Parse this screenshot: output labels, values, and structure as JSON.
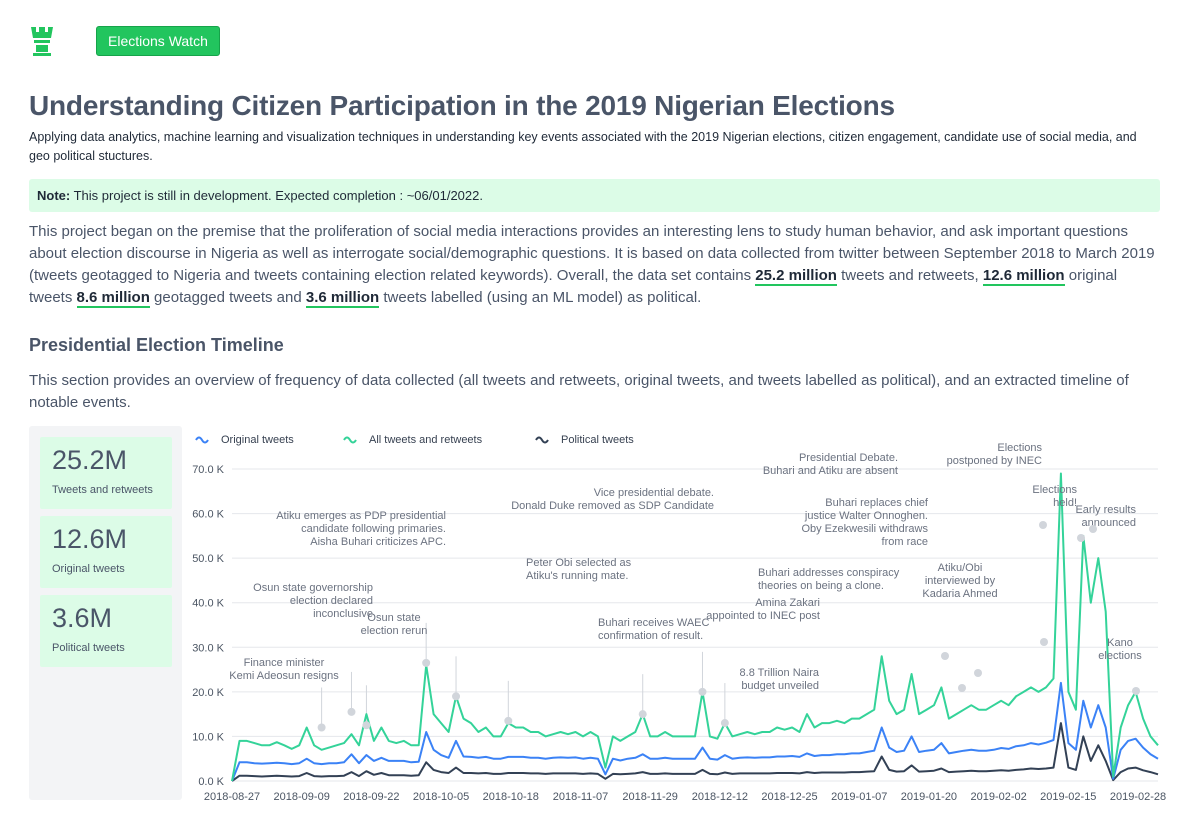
{
  "header": {
    "brand_button": "Elections Watch",
    "title": "Understanding Citizen Participation in the 2019 Nigerian Elections",
    "subtitle": "Applying data analytics, machine learning and visualization techniques in understanding key events associated with the 2019 Nigerian elections, citizen engagement, candidate use of social media, and geo political stuctures."
  },
  "note": {
    "label": "Note:",
    "text": "This project is still in development. Expected completion : ~06/01/2022."
  },
  "intro": {
    "p1": "This project began on the premise that the proliferation of social media interactions provides an interesting lens to study human behavior, and ask important questions about election discourse in Nigeria as well as interrogate social/demographic questions. It is based on data collected from twitter between September 2018 to March 2019 (tweets geotagged to Nigeria and tweets containing election related keywords). Overall, the data set contains ",
    "h1": "25.2 million",
    "p2": " tweets and retweets, ",
    "h2": "12.6 million",
    "p3": " original tweets ",
    "h3": "8.6 million",
    "p4": " geotagged tweets and ",
    "h4": "3.6 million",
    "p5": " tweets labelled (using an ML model) as political."
  },
  "section": {
    "heading": "Presidential Election Timeline",
    "description": "This section provides an overview of frequency of data collected (all tweets and retweets, original tweets, and tweets labelled as political), and an extracted timeline of notable events."
  },
  "stats": [
    {
      "value": "25.2M",
      "label": "Tweets and retweets"
    },
    {
      "value": "12.6M",
      "label": "Original tweets"
    },
    {
      "value": "3.6M",
      "label": "Political tweets"
    }
  ],
  "colors": {
    "all": "#34d399",
    "original": "#3b82f6",
    "political": "#334155",
    "accent": "#22c55e"
  },
  "chart_data": {
    "type": "line",
    "ylim": [
      0,
      70000
    ],
    "yticks": [
      "0.0 K",
      "10.0 K",
      "20.0 K",
      "30.0 K",
      "40.0 K",
      "50.0 K",
      "60.0 K",
      "70.0 K"
    ],
    "xticks": [
      "2018-08-27",
      "2018-09-09",
      "2018-09-22",
      "2018-10-05",
      "2018-10-18",
      "2018-11-07",
      "2018-11-29",
      "2018-12-12",
      "2018-12-25",
      "2019-01-07",
      "2019-01-20",
      "2019-02-02",
      "2019-02-15",
      "2019-02-28"
    ],
    "legend": [
      "Original tweets",
      "All tweets and retweets",
      "Political tweets"
    ],
    "series": [
      {
        "name": "All tweets and retweets",
        "key": "all",
        "values": [
          0,
          9000,
          9000,
          8500,
          8000,
          8000,
          8700,
          8000,
          7200,
          8000,
          12000,
          8000,
          7000,
          7500,
          8000,
          8500,
          10500,
          8000,
          15000,
          9000,
          12000,
          9000,
          8500,
          9000,
          8000,
          8000,
          26000,
          15000,
          13000,
          11000,
          19000,
          14000,
          13000,
          11000,
          12000,
          10000,
          10000,
          13000,
          12000,
          12000,
          11000,
          11000,
          10000,
          10500,
          11000,
          10500,
          11000,
          10000,
          11000,
          10000,
          3000,
          10000,
          9000,
          10000,
          11000,
          15000,
          10000,
          10000,
          11000,
          10000,
          10000,
          10000,
          10000,
          20000,
          10000,
          9500,
          13000,
          10000,
          10500,
          11000,
          10500,
          11000,
          11000,
          12000,
          11500,
          12000,
          11000,
          15000,
          12000,
          13000,
          13000,
          13500,
          13000,
          14000,
          14000,
          15000,
          16000,
          28000,
          18000,
          15000,
          16000,
          24000,
          15000,
          16000,
          17000,
          21000,
          14000,
          15000,
          16000,
          17000,
          16000,
          16000,
          17000,
          18000,
          17000,
          19000,
          20000,
          21000,
          20000,
          21000,
          23000,
          69000,
          20000,
          16000,
          55000,
          40000,
          50000,
          38000,
          1000,
          12000,
          17000,
          20000,
          14000,
          10000,
          8000
        ]
      },
      {
        "name": "Original tweets",
        "key": "original",
        "values": [
          0,
          4200,
          4200,
          4000,
          3900,
          4000,
          4100,
          4000,
          3800,
          4000,
          5000,
          4000,
          3800,
          4000,
          4000,
          4200,
          6000,
          4000,
          5800,
          4500,
          5200,
          4500,
          4500,
          4500,
          4200,
          4300,
          11000,
          7000,
          5800,
          5200,
          9000,
          5500,
          5400,
          5200,
          5400,
          5000,
          5000,
          5400,
          5400,
          5400,
          5200,
          5200,
          5000,
          5200,
          5300,
          5200,
          5300,
          5000,
          5200,
          5000,
          1500,
          5000,
          4600,
          5000,
          5200,
          6000,
          5000,
          5000,
          5200,
          5000,
          5000,
          5000,
          5000,
          7500,
          5000,
          4800,
          5800,
          5000,
          5200,
          5300,
          5200,
          5300,
          5300,
          5500,
          5500,
          5600,
          5400,
          6200,
          5600,
          5800,
          5800,
          6000,
          6000,
          6200,
          6200,
          6500,
          6800,
          12000,
          7500,
          6500,
          6800,
          10000,
          6500,
          6800,
          7000,
          8500,
          6200,
          6500,
          6800,
          7000,
          6800,
          6800,
          7000,
          7400,
          7200,
          7800,
          8000,
          8500,
          8200,
          8600,
          9200,
          22000,
          8500,
          7000,
          18000,
          12000,
          17000,
          12000,
          500,
          7000,
          9000,
          9500,
          7500,
          6000,
          5000
        ]
      },
      {
        "name": "Political tweets",
        "key": "political",
        "values": [
          0,
          1200,
          1200,
          1100,
          1000,
          1100,
          1200,
          1100,
          1000,
          1100,
          1800,
          1100,
          1000,
          1100,
          1100,
          1200,
          2000,
          1100,
          2200,
          1400,
          1800,
          1300,
          1300,
          1300,
          1200,
          1300,
          4200,
          2500,
          2000,
          1800,
          3000,
          1800,
          1800,
          1700,
          1800,
          1600,
          1600,
          1800,
          1800,
          1800,
          1700,
          1700,
          1600,
          1700,
          1700,
          1700,
          1700,
          1600,
          1700,
          1600,
          500,
          1600,
          1500,
          1600,
          1700,
          2000,
          1600,
          1600,
          1700,
          1600,
          1600,
          1600,
          1600,
          2500,
          1600,
          1500,
          1900,
          1600,
          1700,
          1700,
          1700,
          1700,
          1700,
          1800,
          1800,
          1800,
          1700,
          2000,
          1800,
          1900,
          1900,
          1900,
          1900,
          2000,
          2000,
          2100,
          2200,
          5500,
          2500,
          2100,
          2200,
          3500,
          2100,
          2200,
          2300,
          2800,
          2000,
          2100,
          2200,
          2300,
          2200,
          2200,
          2300,
          2400,
          2300,
          2500,
          2600,
          2800,
          2700,
          2800,
          3000,
          13000,
          3000,
          2500,
          10000,
          4500,
          8000,
          4500,
          200,
          2000,
          2800,
          3000,
          2400,
          2000,
          1500
        ]
      }
    ],
    "annotations": [
      {
        "text": [
          "Finance minister",
          "Kemi Adeosun resigns"
        ],
        "x": 12,
        "y": 12000
      },
      {
        "text": [
          "Osun state governorship",
          "election declared",
          "inconclusive"
        ],
        "x": 16,
        "y": 15500
      },
      {
        "text": [
          "Osun state",
          "election rerun"
        ],
        "x": 18,
        "y": 12500
      },
      {
        "text": [
          "Atiku emerges as PDP presidential",
          "candidate following primaries.",
          "Aisha Buhari criticizes APC."
        ],
        "x": 26,
        "y": 26500
      },
      {
        "text": [
          "Peter Obi selected as",
          "Atiku's running mate."
        ],
        "x": 30,
        "y": 19000
      },
      {
        "text": [
          "Buhari receives WAEC",
          "confirmation of result."
        ],
        "x": 37,
        "y": 13500
      },
      {
        "text": [
          "Vice presidential debate.",
          "Donald Duke removed as SDP Candidate"
        ],
        "x": 0,
        "y": 0
      },
      {
        "text": [
          "Buhari addresses conspiracy",
          "theories on being a clone."
        ],
        "x": 55,
        "y": 15000
      },
      {
        "text": [
          "Amina Zakari",
          "appointed to INEC post"
        ],
        "x": 63,
        "y": 20000
      },
      {
        "text": [
          "8.8 Trillion Naira",
          "budget unveiled"
        ],
        "x": 66,
        "y": 13000
      },
      {
        "text": [
          "Presidential Debate.",
          "Buhari and Atiku are absent"
        ],
        "x": 0,
        "y": 0
      },
      {
        "text": [
          "Buhari replaces chief",
          "justice Walter Onnoghen.",
          "Oby Ezekwesili withdraws",
          "from race"
        ],
        "x": 0,
        "y": 0
      },
      {
        "text": [
          "Atiku/Obi",
          "interviewed by",
          "Kadaria Ahmed"
        ],
        "x": 0,
        "y": 0
      },
      {
        "text": [
          "Elections",
          "postponed by INEC"
        ],
        "x": 0,
        "y": 0
      },
      {
        "text": [
          "Elections",
          "held!"
        ],
        "x": 0,
        "y": 0
      },
      {
        "text": [
          "Early results",
          "announced"
        ],
        "x": 0,
        "y": 0
      },
      {
        "text": [
          "Kano",
          "elections"
        ],
        "x": 0,
        "y": 0
      }
    ]
  }
}
